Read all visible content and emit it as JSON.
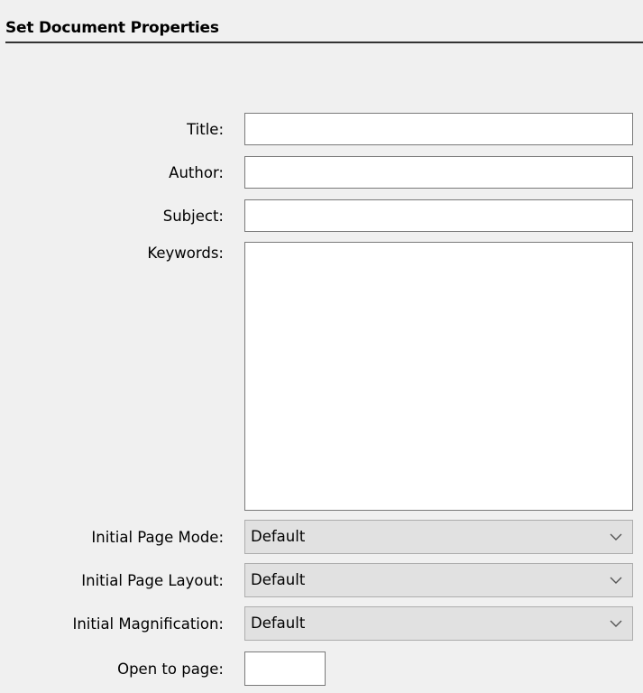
{
  "section": {
    "title": "Set Document Properties"
  },
  "fields": {
    "title": {
      "label": "Title:",
      "value": ""
    },
    "author": {
      "label": "Author:",
      "value": ""
    },
    "subject": {
      "label": "Subject:",
      "value": ""
    },
    "keywords": {
      "label": "Keywords:",
      "value": ""
    }
  },
  "dropdowns": {
    "page_mode": {
      "label": "Initial Page Mode:",
      "value": "Default",
      "icon": "chevron-down-icon"
    },
    "page_layout": {
      "label": "Initial Page Layout:",
      "value": "Default",
      "icon": "chevron-down-icon"
    },
    "magnification": {
      "label": "Initial Magnification:",
      "value": "Default",
      "icon": "chevron-down-icon"
    }
  },
  "open_to_page": {
    "label": "Open to page:",
    "value": ""
  }
}
